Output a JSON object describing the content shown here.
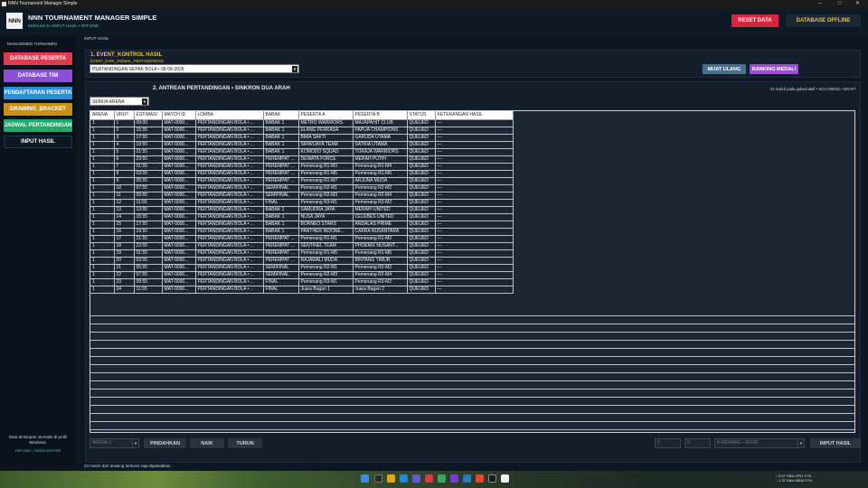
{
  "window": {
    "title": "NNN Tournament Manager Simple",
    "controls": [
      "─",
      "□",
      "✕"
    ]
  },
  "header": {
    "logo": "NNN",
    "title": "NNN TOURNAMENT MANAGER SIMPLE",
    "subtitle": "MODULE 6 • INPUT HASIL • OFFLINE",
    "reset_label": "RESET DATA",
    "db_label": "DATABASE OFFLINE"
  },
  "sidebar": {
    "heading": "MANAJEMEN TURNAMEN",
    "items": [
      {
        "label": "DATABASE PESERTA",
        "color": "#e23a4f"
      },
      {
        "label": "DATABASE TIM",
        "color": "#8a4fd6"
      },
      {
        "label": "PENDAFTARAN PESERTA",
        "color": "#2d8fd8"
      },
      {
        "label": "DRAWING_BRACKET",
        "color": "#c99018"
      },
      {
        "label": "JADWAL PERTANDINGAN",
        "color": "#22a86a"
      },
      {
        "label": "INPUT HASIL",
        "color": "#0f1822"
      }
    ],
    "note": "Data tersimpan otomatis di profil Windows.",
    "status": "OFFLINE • TANPA SERVER"
  },
  "breadcrumb": "INPUT HASIL",
  "panel1": {
    "title": "1. EVENT_KONTROL HASIL",
    "subtitle": "EVENT_DARI_JADWAL_PERTANDINGAN",
    "event_value": "PERTANDINGAN SEPAK BOLA • 08-08-2026",
    "reload_label": "MUAT ULANG",
    "medal_label": "RANKING MEDALI"
  },
  "panel2": {
    "title": "2. ANTREAN PERTANDINGAN • SINKRON DUA ARAH",
    "note": "24 match pada jadwal aktif • SCH 000001 • DRAFT",
    "arena_filter": "SEMUA ARENA"
  },
  "table": {
    "columns": [
      "ARENA",
      "URUT",
      "ESTIMASI",
      "MATCH ID",
      "LOMBA",
      "BABAK",
      "PESERTA A",
      "PESERTA B",
      "STATUS",
      "KETERANGAN HASIL"
    ],
    "rows": [
      [
        "1",
        "1",
        "09:00",
        "MAT-0000...",
        "PERTANDINGAN BOLA • ...",
        "BABAK 1",
        "METRO WARRIORS",
        "MAJAPAHIT CLUB",
        "QUEUED",
        "—"
      ],
      [
        "1",
        "2",
        "15:55",
        "MAT-0000...",
        "PERTANDINGAN BOLA • ...",
        "BABAK 1",
        "ELANG PERKASA",
        "PAPUA CHAMPIONS",
        "QUEUED",
        "—"
      ],
      [
        "1",
        "3",
        "17:55",
        "MAT-0000...",
        "PERTANDINGAN BOLA • ...",
        "BABAK 1",
        "BIMA SAKTI",
        "GARUDA UTAMA",
        "QUEUED",
        "—"
      ],
      [
        "1",
        "4",
        "19:55",
        "MAT-0000...",
        "PERTANDINGAN BOLA • ...",
        "BABAK 1",
        "SRIWIJAYA TEAM",
        "SATRIA UTAMA",
        "QUEUED",
        "—"
      ],
      [
        "1",
        "5",
        "21:55",
        "MAT-0000...",
        "PERTANDINGAN BOLA • ...",
        "BABAK 1",
        "KOMODO SQUAD",
        "TORAJA WARRIORS",
        "QUEUED",
        "—"
      ],
      [
        "1",
        "6",
        "23:55",
        "MAT-0000...",
        "PERTANDINGAN BOLA • ...",
        "PEREMPAT ...",
        "DEWATA FORCE",
        "MERAH PUTIH",
        "QUEUED",
        "—"
      ],
      [
        "1",
        "7",
        "01:55",
        "MAT-0000...",
        "PERTANDINGAN BOLA • ...",
        "PEREMPAT ...",
        "Pemenang R1-M3",
        "Pemenang R1-M4",
        "QUEUED",
        "—"
      ],
      [
        "1",
        "8",
        "03:55",
        "MAT-0000...",
        "PERTANDINGAN BOLA • ...",
        "PEREMPAT ...",
        "Pemenang R1-M5",
        "Pemenang R1-M6",
        "QUEUED",
        "—"
      ],
      [
        "1",
        "9",
        "05:55",
        "MAT-0000...",
        "PERTANDINGAN BOLA • ...",
        "PEREMPAT ...",
        "Pemenang R1-M7",
        "ARJUNA MUDA",
        "QUEUED",
        "—"
      ],
      [
        "1",
        "10",
        "07:55",
        "MAT-0000...",
        "PERTANDINGAN BOLA • ...",
        "SEMIFINAL",
        "Pemenang R2-M1",
        "Pemenang R2-M2",
        "QUEUED",
        "—"
      ],
      [
        "1",
        "11",
        "09:55",
        "MAT-0000...",
        "PERTANDINGAN BOLA • ...",
        "SEMIFINAL",
        "Pemenang R2-M3",
        "Pemenang R2-M4",
        "QUEUED",
        "—"
      ],
      [
        "1",
        "12",
        "11:55",
        "MAT-0000...",
        "PERTANDINGAN BOLA • ...",
        "FINAL",
        "Pemenang R3-M1",
        "Pemenang R3-M2",
        "QUEUED",
        "—"
      ],
      [
        "1",
        "13",
        "13:55",
        "MAT-0000...",
        "PERTANDINGAN BOLA • ...",
        "BABAK 1",
        "SAMUDRA JAYA",
        "MERAPI UNITED",
        "QUEUED",
        "—"
      ],
      [
        "1",
        "14",
        "15:55",
        "MAT-0000...",
        "PERTANDINGAN BOLA • ...",
        "BABAK 1",
        "NUSA JAYA",
        "CELEBES UNITED",
        "QUEUED",
        "—"
      ],
      [
        "1",
        "15",
        "17:55",
        "MAT-0000...",
        "PERTANDINGAN BOLA • ...",
        "BABAK 1",
        "BORNEO STARS",
        "ANDALAS PRIME",
        "QUEUED",
        "—"
      ],
      [
        "1",
        "16",
        "19:55",
        "MAT-0000...",
        "PERTANDINGAN BOLA • ...",
        "BABAK 1",
        "PANTHER INDONE...",
        "CAKRA NUSANTARA",
        "QUEUED",
        "—"
      ],
      [
        "1",
        "17",
        "21:55",
        "MAT-0000...",
        "PERTANDINGAN BOLA • ...",
        "PEREMPAT ...",
        "Pemenang R1-M1",
        "Pemenang R1-M2",
        "QUEUED",
        "—"
      ],
      [
        "1",
        "18",
        "23:55",
        "MAT-0000...",
        "PERTANDINGAN BOLA • ...",
        "PEREMPAT ...",
        "SENTINEL TEAM",
        "PHOENIX NUSANT...",
        "QUEUED",
        "—"
      ],
      [
        "1",
        "19",
        "01:55",
        "MAT-0000...",
        "PERTANDINGAN BOLA • ...",
        "PEREMPAT ...",
        "Pemenang R1-M5",
        "Pemenang R1-M6",
        "QUEUED",
        "—"
      ],
      [
        "1",
        "20",
        "03:55",
        "MAT-0000...",
        "PERTANDINGAN BOLA • ...",
        "PEREMPAT ...",
        "RAJAWALI MUDA",
        "BINTANG TIMUR",
        "QUEUED",
        "—"
      ],
      [
        "1",
        "21",
        "05:55",
        "MAT-0000...",
        "PERTANDINGAN BOLA • ...",
        "SEMIFINAL",
        "Pemenang R2-M1",
        "Pemenang R2-M2",
        "QUEUED",
        "—"
      ],
      [
        "1",
        "22",
        "07:55",
        "MAT-0000...",
        "PERTANDINGAN BOLA • ...",
        "SEMIFINAL",
        "Pemenang R2-M3",
        "Pemenang R2-M4",
        "QUEUED",
        "—"
      ],
      [
        "1",
        "23",
        "09:55",
        "MAT-0000...",
        "PERTANDINGAN BOLA • ...",
        "FINAL",
        "Pemenang R3-M1",
        "Pemenang R3-M2",
        "QUEUED",
        "—"
      ],
      [
        "1",
        "24",
        "11:55",
        "MAT-0000...",
        "PERTANDINGAN BOLA • ...",
        "FINAL",
        "Juara Bagan 1",
        "Juara Bagan 2",
        "QUEUED",
        "—"
      ]
    ]
  },
  "bottom": {
    "arena_value": "ARENA 1",
    "pindahkan": "PINDAHKAN",
    "naik": "NAIK",
    "turun": "TURUN",
    "score_a": "0",
    "score_b": "0",
    "result_value": "A MENANG • SKOR",
    "input_label": "INPUT HASIL"
  },
  "footnote": "24 match dari drawing terkunci siap dijadwalkan.",
  "tray": {
    "line1": "↑ 5.27 KB/s   CPU 17%",
    "line2": "↓ 1.37 KB/s   MEM 27%"
  }
}
